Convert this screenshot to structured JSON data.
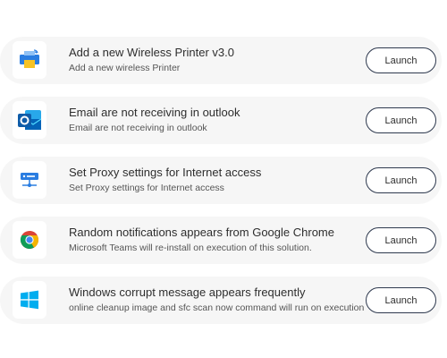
{
  "solutions": [
    {
      "icon": "printer-icon",
      "title": "Add a new Wireless Printer v3.0",
      "subtitle": "Add a new wireless Printer",
      "action_label": "Launch"
    },
    {
      "icon": "outlook-icon",
      "title": "Email are not receiving in outlook",
      "subtitle": "Email are not receiving in outlook",
      "action_label": "Launch"
    },
    {
      "icon": "proxy-network-icon",
      "title": "Set Proxy settings for Internet access",
      "subtitle": "Set Proxy settings for Internet access",
      "action_label": "Launch"
    },
    {
      "icon": "chrome-icon",
      "title": "Random notifications appears from Google Chrome",
      "subtitle": "Microsoft Teams will re-install on execution of this solution.",
      "action_label": "Launch"
    },
    {
      "icon": "windows-icon",
      "title": "Windows corrupt message appears frequently",
      "subtitle": "online cleanup image and sfc scan now command will run on execution",
      "action_label": "Launch"
    }
  ]
}
